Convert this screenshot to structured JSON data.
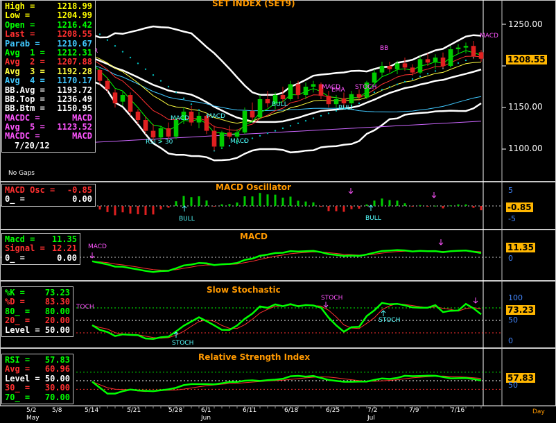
{
  "colors": {
    "background": "#000000",
    "frame": "#c8c8c8",
    "price_up": "#00cc00",
    "price_down": "#e02020",
    "bb": "#ffffff",
    "parab": "#00bbbb",
    "avg1": "#00ff00",
    "avg2": "#ff3030",
    "avg3": "#ffff40",
    "avg4": "#40c8ff",
    "avg5": "#cc66ff",
    "signal_magenta": "#ff55ff",
    "signal_cyan": "#55ffff",
    "title": "#ff9900",
    "last_tag": "#ffb600"
  },
  "main": {
    "title": "SET INDEX (SET9)",
    "legend": [
      {
        "label": "High",
        "value": "1218.99",
        "color": "#ffff00"
      },
      {
        "label": "Low",
        "value": "1204.99",
        "color": "#ffff00"
      },
      {
        "label": "Open",
        "value": "1216.42",
        "color": "#00ff00"
      },
      {
        "label": "Last",
        "value": "1208.55",
        "color": "#ff3030"
      },
      {
        "label": "Parab",
        "value": "1210.67",
        "color": "#40c8ff"
      },
      {
        "label": "Avg  1",
        "value": "1212.31",
        "color": "#00ff00"
      },
      {
        "label": "Avg  2",
        "value": "1207.88",
        "color": "#ff3030"
      },
      {
        "label": "Avg  3",
        "value": "1192.28",
        "color": "#ffff40"
      },
      {
        "label": "Avg  4",
        "value": "1170.17",
        "color": "#40c8ff"
      },
      {
        "label": "BB.Avg",
        "value": "1193.72",
        "color": "#ffffff"
      },
      {
        "label": "BB.Top",
        "value": "1236.49",
        "color": "#ffffff"
      },
      {
        "label": "BB.Btm",
        "value": "1150.95",
        "color": "#ffffff"
      },
      {
        "label": "MACDC",
        "value": "MACD",
        "color": "#ff55ff"
      },
      {
        "label": "Avg  5",
        "value": "1123.52",
        "color": "#ff55ff"
      },
      {
        "label": "MACDC",
        "value": "MACD",
        "color": "#ff55ff"
      }
    ],
    "legend_date": "7/20/12",
    "no_gaps": "No  Gaps",
    "last_value": "1208.55",
    "y_ticks": [
      "1250.00",
      "1200.00",
      "1150.00",
      "1100.00"
    ],
    "annotations": [
      "MACD",
      "MACD",
      "MACD",
      "BB",
      "MACD",
      "EMA",
      "BULL",
      "BULL",
      "STOCH",
      "RSI > 30",
      "MACD",
      "R"
    ]
  },
  "macd_osc": {
    "title": "MACD Oscillator",
    "legend": [
      {
        "label": "MACD Osc",
        "value": "-0.85",
        "color": "#ff3030"
      },
      {
        "label": "0_",
        "value": "0.00",
        "color": "#ffffff"
      }
    ],
    "last_value": "-0.85",
    "y_ticks": [
      "5",
      "-5"
    ],
    "annotations": [
      "BULL",
      "BULL"
    ]
  },
  "macd": {
    "title": "MACD",
    "legend": [
      {
        "label": "Macd",
        "value": "11.35",
        "color": "#00ff00"
      },
      {
        "label": "Signal",
        "value": "12.21",
        "color": "#ff3030"
      },
      {
        "label": "0_",
        "value": "0.00",
        "color": "#ffffff"
      }
    ],
    "last_value": "11.35",
    "y_ticks": [
      "0"
    ],
    "annotations": [
      "MACD"
    ]
  },
  "stoch": {
    "title": "Slow  Stochastic",
    "legend": [
      {
        "label": "%K",
        "value": "73.23",
        "color": "#00ff00"
      },
      {
        "label": "%D",
        "value": "83.30",
        "color": "#ff3030"
      },
      {
        "label": "80_",
        "value": "80.00",
        "color": "#00ff00"
      },
      {
        "label": "20_",
        "value": "20.00",
        "color": "#ff3030"
      },
      {
        "label": "Level",
        "value": "50.00",
        "color": "#ffffff"
      }
    ],
    "last_value": "73.23",
    "y_ticks": [
      "100",
      "50",
      "0"
    ],
    "annotations": [
      "TOCH",
      "STOCH",
      "STOCH",
      "STOCH"
    ]
  },
  "rsi": {
    "title": "Relative  Strength  Index",
    "legend": [
      {
        "label": "RSI",
        "value": "57.83",
        "color": "#00ff00"
      },
      {
        "label": "Avg",
        "value": "60.96",
        "color": "#ff3030"
      },
      {
        "label": "Level",
        "value": "50.00",
        "color": "#ffffff"
      },
      {
        "label": "30_",
        "value": "30.00",
        "color": "#ff3030"
      },
      {
        "label": "70_",
        "value": "70.00",
        "color": "#00ff00"
      }
    ],
    "last_value": "57.83",
    "y_ticks": [
      "50"
    ]
  },
  "x_axis": {
    "labels": [
      "5/2",
      "5/8",
      "5/14",
      "5/21",
      "5/28",
      "6/1",
      "6/11",
      "6/18",
      "6/25",
      "7/2",
      "7/9",
      "7/16"
    ],
    "months": [
      "May",
      "Jun",
      "Jul"
    ],
    "unit": "Day"
  },
  "chart_data": {
    "type": "candlestick",
    "title": "SET INDEX (SET9)",
    "x": [
      "5/10",
      "5/11",
      "5/14",
      "5/15",
      "5/16",
      "5/17",
      "5/18",
      "5/21",
      "5/22",
      "5/23",
      "5/24",
      "5/25",
      "5/28",
      "5/29",
      "5/30",
      "5/31",
      "6/1",
      "6/4",
      "6/5",
      "6/6",
      "6/7",
      "6/8",
      "6/11",
      "6/12",
      "6/13",
      "6/14",
      "6/15",
      "6/18",
      "6/19",
      "6/20",
      "6/21",
      "6/22",
      "6/25",
      "6/26",
      "6/27",
      "6/28",
      "6/29",
      "7/2",
      "7/3",
      "7/4",
      "7/5",
      "7/6",
      "7/9",
      "7/10",
      "7/11",
      "7/12",
      "7/13",
      "7/16",
      "7/17",
      "7/18",
      "7/19",
      "7/20"
    ],
    "ohlc": [
      [
        1198,
        1203,
        1190,
        1195
      ],
      [
        1195,
        1197,
        1178,
        1182
      ],
      [
        1182,
        1186,
        1168,
        1172
      ],
      [
        1168,
        1172,
        1150,
        1155
      ],
      [
        1157,
        1170,
        1152,
        1165
      ],
      [
        1165,
        1168,
        1140,
        1145
      ],
      [
        1145,
        1148,
        1130,
        1135
      ],
      [
        1135,
        1140,
        1118,
        1122
      ],
      [
        1122,
        1130,
        1110,
        1114
      ],
      [
        1114,
        1128,
        1108,
        1125
      ],
      [
        1125,
        1132,
        1112,
        1115
      ],
      [
        1115,
        1138,
        1112,
        1135
      ],
      [
        1135,
        1150,
        1130,
        1145
      ],
      [
        1145,
        1152,
        1128,
        1132
      ],
      [
        1132,
        1145,
        1125,
        1140
      ],
      [
        1140,
        1142,
        1118,
        1122
      ],
      [
        1122,
        1128,
        1098,
        1103
      ],
      [
        1103,
        1122,
        1100,
        1120
      ],
      [
        1120,
        1128,
        1112,
        1115
      ],
      [
        1115,
        1124,
        1108,
        1120
      ],
      [
        1120,
        1150,
        1118,
        1146
      ],
      [
        1146,
        1156,
        1135,
        1138
      ],
      [
        1138,
        1165,
        1136,
        1160
      ],
      [
        1160,
        1170,
        1150,
        1155
      ],
      [
        1155,
        1168,
        1148,
        1165
      ],
      [
        1165,
        1175,
        1156,
        1160
      ],
      [
        1160,
        1182,
        1158,
        1178
      ],
      [
        1178,
        1182,
        1160,
        1165
      ],
      [
        1165,
        1180,
        1160,
        1175
      ],
      [
        1175,
        1182,
        1168,
        1178
      ],
      [
        1178,
        1180,
        1160,
        1164
      ],
      [
        1164,
        1170,
        1150,
        1154
      ],
      [
        1154,
        1165,
        1150,
        1160
      ],
      [
        1160,
        1168,
        1150,
        1155
      ],
      [
        1155,
        1170,
        1152,
        1166
      ],
      [
        1166,
        1172,
        1158,
        1162
      ],
      [
        1162,
        1182,
        1160,
        1180
      ],
      [
        1180,
        1196,
        1176,
        1192
      ],
      [
        1192,
        1205,
        1188,
        1200
      ],
      [
        1200,
        1205,
        1192,
        1196
      ],
      [
        1196,
        1206,
        1190,
        1203
      ],
      [
        1203,
        1210,
        1194,
        1198
      ],
      [
        1198,
        1202,
        1188,
        1192
      ],
      [
        1192,
        1212,
        1190,
        1208
      ],
      [
        1208,
        1215,
        1200,
        1204
      ],
      [
        1204,
        1214,
        1196,
        1210
      ],
      [
        1210,
        1216,
        1196,
        1200
      ],
      [
        1200,
        1224,
        1198,
        1220
      ],
      [
        1220,
        1226,
        1214,
        1222
      ],
      [
        1222,
        1228,
        1215,
        1224
      ],
      [
        1224,
        1230,
        1208,
        1212
      ],
      [
        1216.42,
        1218.99,
        1204.99,
        1208.55
      ]
    ],
    "ylim": [
      1070,
      1270
    ]
  }
}
